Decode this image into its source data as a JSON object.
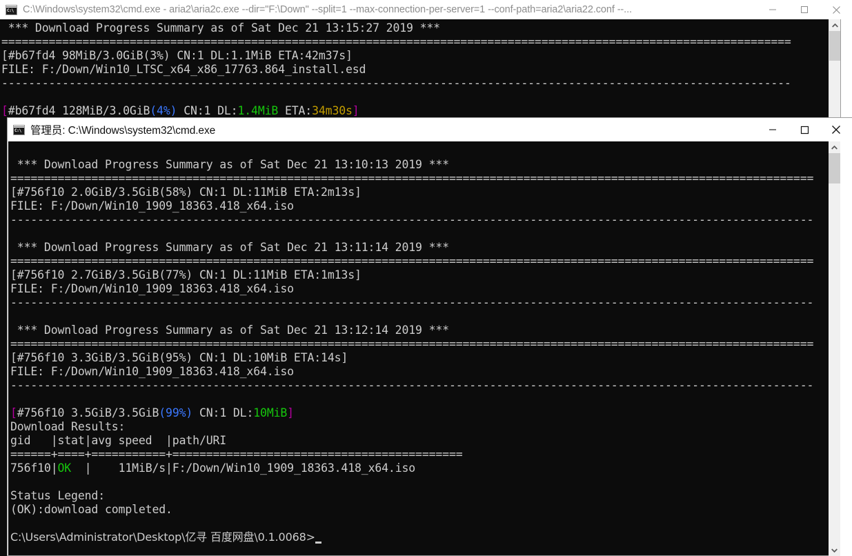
{
  "outer_window": {
    "title": "C:\\Windows\\system32\\cmd.exe - aria2\\aria2c.exe  --dir=\"F:\\Down\" --split=1 --max-connection-per-server=1 --conf-path=aria2\\aria22.conf --...",
    "icon": "cmd-icon",
    "buttons": {
      "minimize": "minimize-button",
      "maximize": "maximize-button",
      "close": "close-button"
    },
    "console_lines": [
      {
        "id": "o1",
        "segments": [
          {
            "text": " *** Download Progress Summary as of Sat Dec 21 13:15:27 2019 ***",
            "color": "default"
          }
        ]
      },
      {
        "id": "o2",
        "segments": [
          {
            "text": "=====================================================================================================================",
            "color": "default"
          }
        ]
      },
      {
        "id": "o3",
        "segments": [
          {
            "text": "[#b67fd4 98MiB/3.0GiB(3%) CN:1 DL:1.1MiB ETA:42m37s]",
            "color": "default"
          }
        ]
      },
      {
        "id": "o4",
        "segments": [
          {
            "text": "FILE: F:/Down/Win10_LTSC_x64_x86_17763.864_install.esd",
            "color": "default"
          }
        ]
      },
      {
        "id": "o5",
        "segments": [
          {
            "text": "---------------------------------------------------------------------------------------------------------------------",
            "color": "default"
          }
        ]
      },
      {
        "id": "o6",
        "segments": [
          {
            "text": "",
            "color": "default"
          }
        ]
      },
      {
        "id": "o7",
        "segments": [
          {
            "text": "[",
            "color": "magenta"
          },
          {
            "text": "#b67fd4 128MiB/3.0GiB",
            "color": "default"
          },
          {
            "text": "(4%)",
            "color": "blue"
          },
          {
            "text": " CN:1 DL:",
            "color": "default"
          },
          {
            "text": "1.4MiB",
            "color": "green"
          },
          {
            "text": " ETA:",
            "color": "default"
          },
          {
            "text": "34m30s",
            "color": "yellow"
          },
          {
            "text": "]",
            "color": "magenta"
          }
        ]
      }
    ],
    "scrollbar": {
      "up_arrow": "scroll-up-arrow",
      "down_arrow": "scroll-down-arrow"
    }
  },
  "inner_window": {
    "title": "管理员: C:\\Windows\\system32\\cmd.exe",
    "icon": "cmd-icon",
    "buttons": {
      "minimize": "minimize-button",
      "maximize": "maximize-button",
      "close": "close-button"
    },
    "console_lines": [
      {
        "id": "i1",
        "segments": [
          {
            "text": "",
            "color": "default"
          }
        ]
      },
      {
        "id": "i2",
        "segments": [
          {
            "text": " *** Download Progress Summary as of Sat Dec 21 13:10:13 2019 ***",
            "color": "default"
          }
        ]
      },
      {
        "id": "i3",
        "segments": [
          {
            "text": "=======================================================================================================================",
            "color": "default"
          }
        ]
      },
      {
        "id": "i4",
        "segments": [
          {
            "text": "[#756f10 2.0GiB/3.5GiB(58%) CN:1 DL:11MiB ETA:2m13s]",
            "color": "default"
          }
        ]
      },
      {
        "id": "i5",
        "segments": [
          {
            "text": "FILE: F:/Down/Win10_1909_18363.418_x64.iso",
            "color": "default"
          }
        ]
      },
      {
        "id": "i6",
        "segments": [
          {
            "text": "-----------------------------------------------------------------------------------------------------------------------",
            "color": "default"
          }
        ]
      },
      {
        "id": "i7",
        "segments": [
          {
            "text": "",
            "color": "default"
          }
        ]
      },
      {
        "id": "i8",
        "segments": [
          {
            "text": " *** Download Progress Summary as of Sat Dec 21 13:11:14 2019 ***",
            "color": "default"
          }
        ]
      },
      {
        "id": "i9",
        "segments": [
          {
            "text": "=======================================================================================================================",
            "color": "default"
          }
        ]
      },
      {
        "id": "i10",
        "segments": [
          {
            "text": "[#756f10 2.7GiB/3.5GiB(77%) CN:1 DL:11MiB ETA:1m13s]",
            "color": "default"
          }
        ]
      },
      {
        "id": "i11",
        "segments": [
          {
            "text": "FILE: F:/Down/Win10_1909_18363.418_x64.iso",
            "color": "default"
          }
        ]
      },
      {
        "id": "i12",
        "segments": [
          {
            "text": "-----------------------------------------------------------------------------------------------------------------------",
            "color": "default"
          }
        ]
      },
      {
        "id": "i13",
        "segments": [
          {
            "text": "",
            "color": "default"
          }
        ]
      },
      {
        "id": "i14",
        "segments": [
          {
            "text": " *** Download Progress Summary as of Sat Dec 21 13:12:14 2019 ***",
            "color": "default"
          }
        ]
      },
      {
        "id": "i15",
        "segments": [
          {
            "text": "=======================================================================================================================",
            "color": "default"
          }
        ]
      },
      {
        "id": "i16",
        "segments": [
          {
            "text": "[#756f10 3.3GiB/3.5GiB(95%) CN:1 DL:10MiB ETA:14s]",
            "color": "default"
          }
        ]
      },
      {
        "id": "i17",
        "segments": [
          {
            "text": "FILE: F:/Down/Win10_1909_18363.418_x64.iso",
            "color": "default"
          }
        ]
      },
      {
        "id": "i18",
        "segments": [
          {
            "text": "-----------------------------------------------------------------------------------------------------------------------",
            "color": "default"
          }
        ]
      },
      {
        "id": "i19",
        "segments": [
          {
            "text": "",
            "color": "default"
          }
        ]
      },
      {
        "id": "i20",
        "segments": [
          {
            "text": "[",
            "color": "magenta"
          },
          {
            "text": "#756f10 3.5GiB/3.5GiB",
            "color": "default"
          },
          {
            "text": "(99%)",
            "color": "blue"
          },
          {
            "text": " CN:1 DL:",
            "color": "default"
          },
          {
            "text": "10MiB",
            "color": "green"
          },
          {
            "text": "]",
            "color": "magenta"
          }
        ]
      },
      {
        "id": "i21",
        "segments": [
          {
            "text": "Download Results:",
            "color": "default"
          }
        ]
      },
      {
        "id": "i22",
        "segments": [
          {
            "text": "gid   |stat|avg speed  |path/URI",
            "color": "default"
          }
        ]
      },
      {
        "id": "i23",
        "segments": [
          {
            "text": "======+====+===========+===========================================",
            "color": "default"
          }
        ]
      },
      {
        "id": "i24",
        "segments": [
          {
            "text": "756f10|",
            "color": "default"
          },
          {
            "text": "OK",
            "color": "green"
          },
          {
            "text": "  |    11MiB/s|F:/Down/Win10_1909_18363.418_x64.iso",
            "color": "default"
          }
        ]
      },
      {
        "id": "i25",
        "segments": [
          {
            "text": "",
            "color": "default"
          }
        ]
      },
      {
        "id": "i26",
        "segments": [
          {
            "text": "Status Legend:",
            "color": "default"
          }
        ]
      },
      {
        "id": "i27",
        "segments": [
          {
            "text": "(OK):download completed.",
            "color": "default"
          }
        ]
      },
      {
        "id": "i28",
        "segments": [
          {
            "text": "",
            "color": "default"
          }
        ]
      },
      {
        "id": "i29",
        "segments": [
          {
            "text": "C:\\Users\\Administrator\\Desktop\\亿寻 百度网盘\\0.1.0068>",
            "color": "default",
            "caret": true
          }
        ]
      }
    ],
    "scrollbar": {
      "up_arrow": "scroll-up-arrow",
      "down_arrow": "scroll-down-arrow"
    }
  },
  "colors": {
    "console_bg": "#0c0c0c",
    "console_fg": "#cccccc",
    "magenta": "#b4009e",
    "blue": "#3b78ff",
    "green": "#16c60c",
    "yellow": "#c19c00",
    "titlebar_bg": "#ffffff",
    "scrollbar_track": "#f0f0f0",
    "scrollbar_thumb": "#cdcdcd"
  }
}
